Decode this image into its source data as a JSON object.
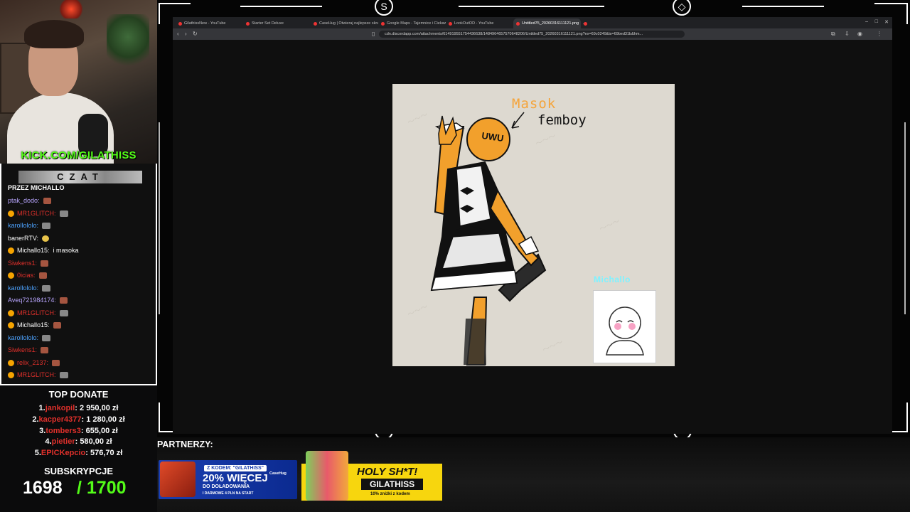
{
  "overlay": {
    "kick_handle": "KICK.COM/GILATHISS",
    "chat": {
      "title": "CZAT",
      "subtitle": "PRZEZ MICHALLO",
      "messages": [
        {
          "user": "ptak_dodo:",
          "color": "#b9a6ff",
          "badge": false,
          "emote": "red",
          "text": ""
        },
        {
          "user": "MR1GLITCH:",
          "color": "#e0302b",
          "badge": true,
          "emote": "cat",
          "text": ""
        },
        {
          "user": "karollololo:",
          "color": "#4da3ff",
          "badge": false,
          "emote": "cat",
          "text": ""
        },
        {
          "user": "banerRTV:",
          "color": "#ffffff",
          "badge": false,
          "emote": "eye",
          "text": ""
        },
        {
          "user": "Michallo15:",
          "color": "#ffffff",
          "badge": true,
          "emote": "",
          "text": "i masoka"
        },
        {
          "user": "Siwkens1:",
          "color": "#e0302b",
          "badge": false,
          "emote": "red",
          "text": ""
        },
        {
          "user": "0icias:",
          "color": "#e0302b",
          "badge": true,
          "emote": "red",
          "text": ""
        },
        {
          "user": "karollololo:",
          "color": "#4da3ff",
          "badge": false,
          "emote": "cat",
          "text": ""
        },
        {
          "user": "Aveq721984174:",
          "color": "#b9a6ff",
          "badge": false,
          "emote": "red",
          "text": ""
        },
        {
          "user": "MR1GLITCH:",
          "color": "#e0302b",
          "badge": true,
          "emote": "cat",
          "text": ""
        },
        {
          "user": "Michallo15:",
          "color": "#ffffff",
          "badge": true,
          "emote": "red",
          "text": ""
        },
        {
          "user": "karollololo:",
          "color": "#4da3ff",
          "badge": false,
          "emote": "cat",
          "text": ""
        },
        {
          "user": "Siwkens1:",
          "color": "#e0302b",
          "badge": false,
          "emote": "red",
          "text": ""
        },
        {
          "user": "relix_2137:",
          "color": "#e0302b",
          "badge": true,
          "emote": "red",
          "text": ""
        },
        {
          "user": "MR1GLITCH:",
          "color": "#e0302b",
          "badge": true,
          "emote": "cat",
          "text": ""
        }
      ]
    },
    "donate": {
      "title": "TOP DONATE",
      "entries": [
        {
          "rank": "1.",
          "name": "jankopil",
          "amount": ": 2 950,00 zł"
        },
        {
          "rank": "2.",
          "name": "kacper4377",
          "amount": ": 1 280,00 zł"
        },
        {
          "rank": "3.",
          "name": "tombers3",
          "amount": ": 655,00 zł"
        },
        {
          "rank": "4.",
          "name": "pietier",
          "amount": ": 580,00 zł"
        },
        {
          "rank": "5.",
          "name": "EPICKepcio",
          "amount": ": 576,70 zł"
        }
      ]
    },
    "subs": {
      "title": "SUBSKRYPCJE",
      "count": "1698",
      "goal": "/ 1700"
    },
    "partners_label": "PARTNERZY:",
    "ads": {
      "casehug": {
        "code": "Z KODEM: \"GILATHISS\"",
        "big": "20% WIĘCEJ",
        "small": "DO DOŁADOWANIA",
        "tiny": "I DARMOWE 4 PLN NA START",
        "brand": "CaseHug"
      },
      "holy": {
        "head": "HOLY SH*T!",
        "code": "GILATHISS",
        "disc": "10% zniżki z kodem"
      }
    }
  },
  "browser": {
    "tabs": [
      {
        "label": "GilathissNew - YouTube",
        "active": false
      },
      {
        "label": "Starter Set Deluxe",
        "active": false
      },
      {
        "label": "CaseHug | Otwieraj najlepsze skrzynki",
        "active": false
      },
      {
        "label": "Google Maps - Tajemnice i Ciekawostki",
        "active": false
      },
      {
        "label": "LookOutOD - YouTube",
        "active": false
      },
      {
        "label": "Untitled75_20260316111121.png",
        "active": true
      }
    ],
    "url": "cdn.discordapp.com/attachments/614919551754436638/1484964657570648206/Untitled75_20260316111121.png?ex=69c0249&is=69bed31b&hm...",
    "window_controls": [
      "–",
      "□",
      "✕"
    ]
  },
  "drawing": {
    "masok": "Masok",
    "femboy": "femboy",
    "uwu": "UWU",
    "michallo": "Michallo"
  },
  "colors": {
    "kick_green": "#53fc18",
    "donate_red": "#e0302b",
    "drawing_bg": "#ddd9d0",
    "skin_orange": "#f2a02c"
  }
}
